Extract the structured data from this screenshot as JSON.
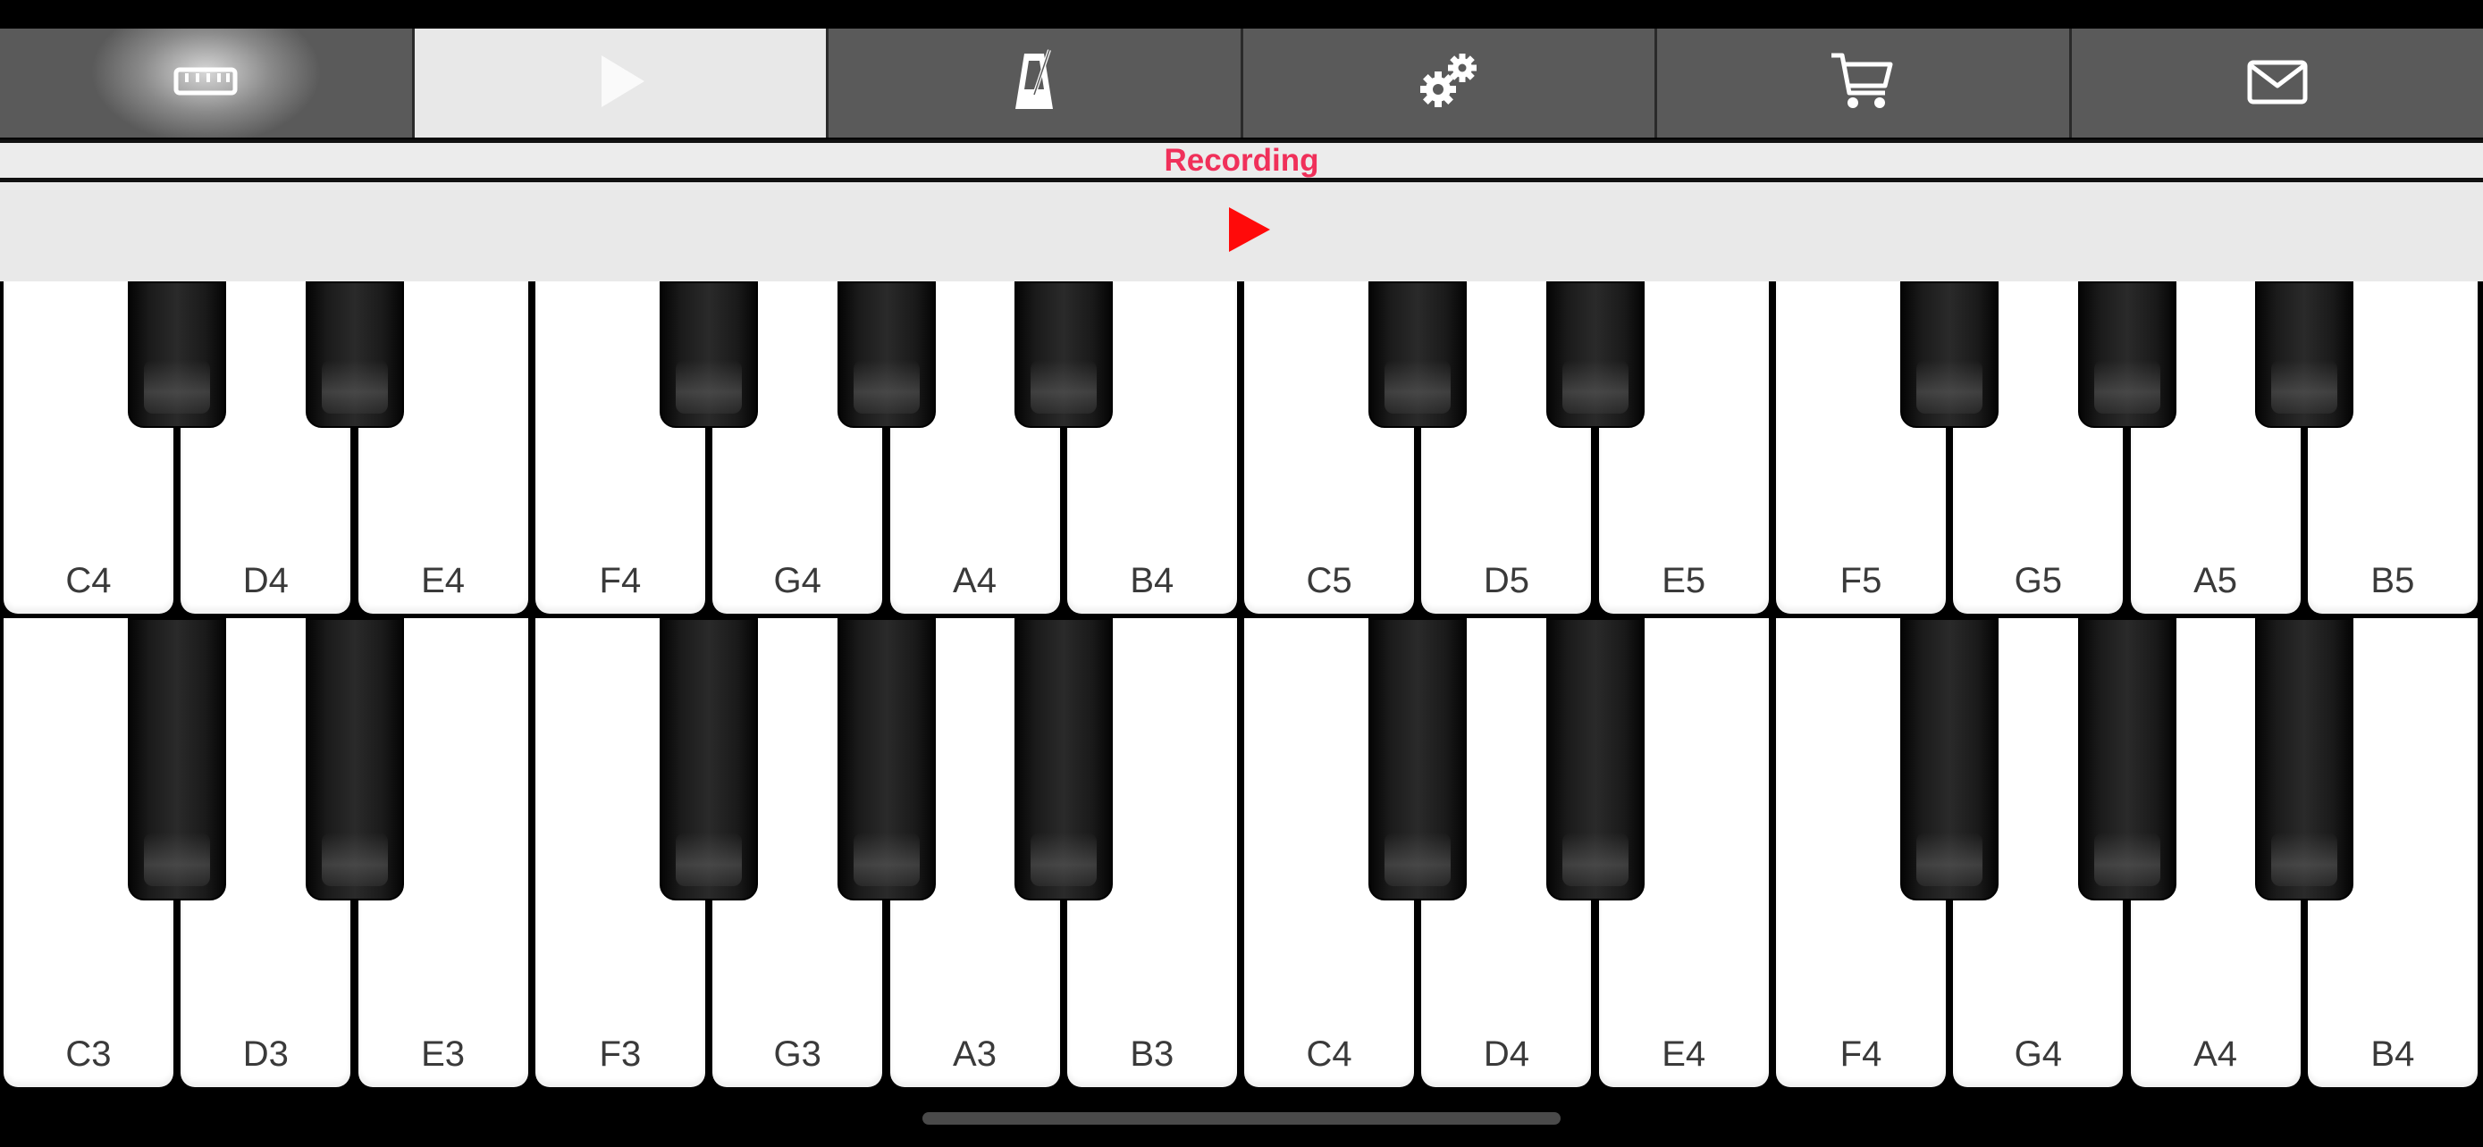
{
  "toolbar": {
    "tabs": [
      {
        "icon": "ruler-icon",
        "state": "glow"
      },
      {
        "icon": "play-icon",
        "state": "active"
      },
      {
        "icon": "metronome-icon",
        "state": "normal"
      },
      {
        "icon": "gears-icon",
        "state": "normal"
      },
      {
        "icon": "cart-icon",
        "state": "normal"
      },
      {
        "icon": "mail-icon",
        "state": "normal"
      }
    ]
  },
  "status": {
    "label": "Recording",
    "label_color": "#f0305a"
  },
  "playback": {
    "play_icon": "play-icon",
    "play_color": "#ff0a0a"
  },
  "keyboards": {
    "upper": {
      "white_keys": [
        "C4",
        "D4",
        "E4",
        "F4",
        "G4",
        "A4",
        "B4",
        "C5",
        "D5",
        "E5",
        "F5",
        "G5",
        "A5",
        "B5"
      ]
    },
    "lower": {
      "white_keys": [
        "C3",
        "D3",
        "E3",
        "F3",
        "G3",
        "A3",
        "B3",
        "C4",
        "D4",
        "E4",
        "F4",
        "G4",
        "A4",
        "B4"
      ]
    }
  }
}
